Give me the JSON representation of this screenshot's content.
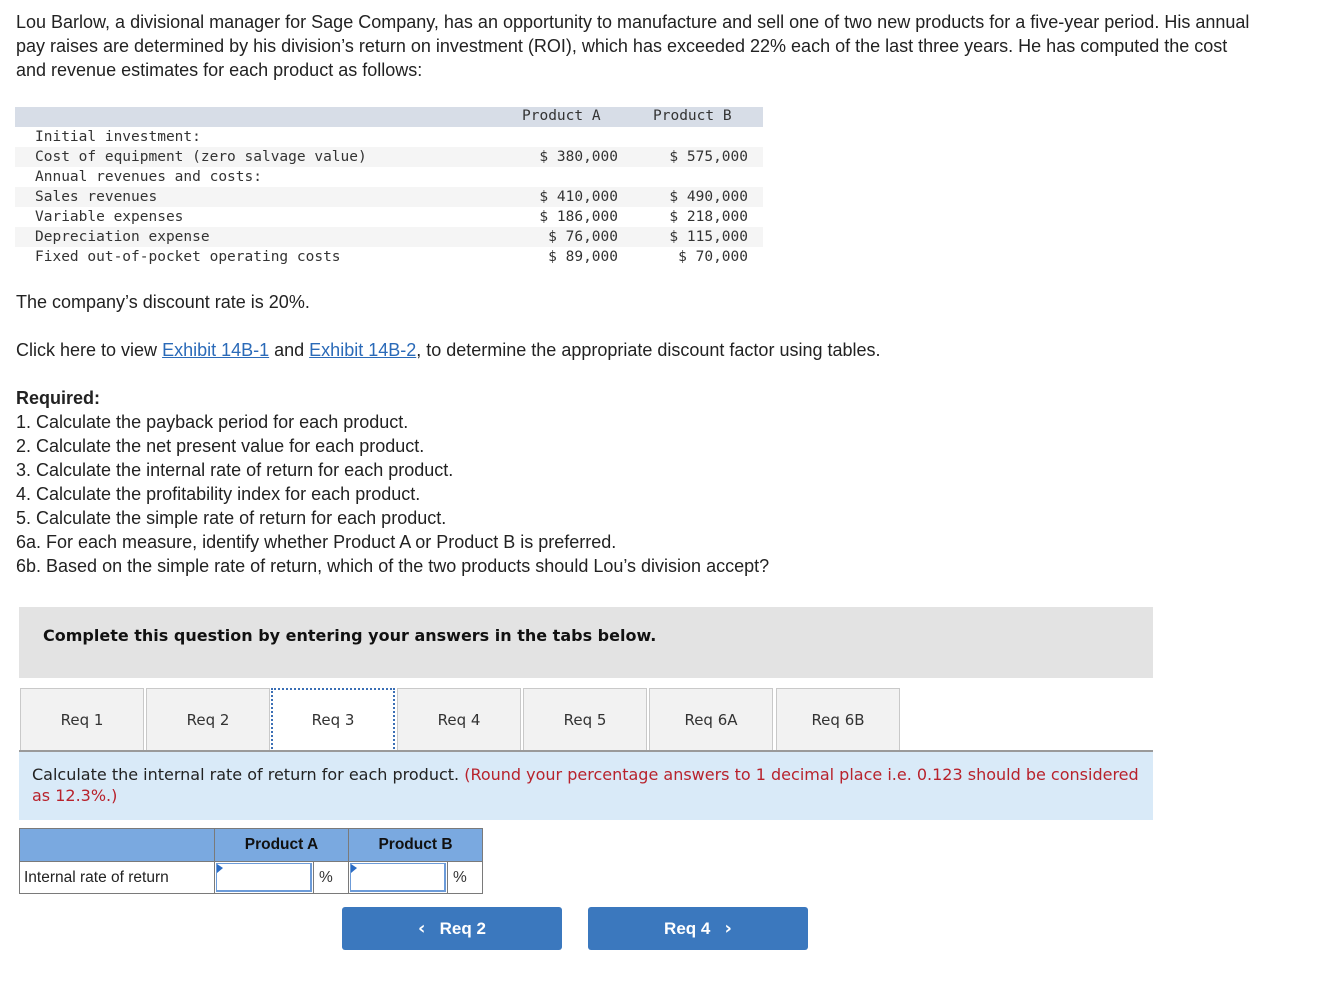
{
  "intro": "Lou Barlow, a divisional manager for Sage Company, has an opportunity to manufacture and sell one of two new products for a five-year period. His annual pay raises are determined by his division’s return on investment (ROI), which has exceeded 22% each of the last three years. He has computed the cost and revenue estimates for each product as follows:",
  "data_table": {
    "columns": [
      "Product A",
      "Product B"
    ],
    "rows": [
      {
        "label": "Initial investment:",
        "a": "",
        "b": ""
      },
      {
        "label": "Cost of equipment (zero salvage value)",
        "a": "$ 380,000",
        "b": "$ 575,000"
      },
      {
        "label": "Annual revenues and costs:",
        "a": "",
        "b": ""
      },
      {
        "label": "Sales revenues",
        "a": "$ 410,000",
        "b": "$ 490,000"
      },
      {
        "label": "Variable expenses",
        "a": "$ 186,000",
        "b": "$ 218,000"
      },
      {
        "label": "Depreciation expense",
        "a": "$ 76,000",
        "b": "$ 115,000"
      },
      {
        "label": "Fixed out-of-pocket operating costs",
        "a": "$ 89,000",
        "b": "$ 70,000"
      }
    ]
  },
  "discount_text": "The company’s discount rate is 20%.",
  "exhibit": {
    "prefix": "Click here to view ",
    "link1": "Exhibit 14B-1",
    "middle": " and ",
    "link2": "Exhibit 14B-2",
    "suffix": ", to determine the appropriate discount factor using tables."
  },
  "required": {
    "title": "Required:",
    "items": [
      "1. Calculate the payback period for each product.",
      "2. Calculate the net present value for each product.",
      "3. Calculate the internal rate of return for each product.",
      "4. Calculate the profitability index for each product.",
      "5. Calculate the simple rate of return for each product.",
      "6a. For each measure, identify whether Product A or Product B is preferred.",
      "6b. Based on the simple rate of return, which of the two products should Lou’s division accept?"
    ]
  },
  "banner": "Complete this question by entering your answers in the tabs below.",
  "tabs": [
    {
      "label": "Req 1",
      "active": false
    },
    {
      "label": "Req 2",
      "active": false
    },
    {
      "label": "Req 3",
      "active": true
    },
    {
      "label": "Req 4",
      "active": false
    },
    {
      "label": "Req 5",
      "active": false
    },
    {
      "label": "Req 6A",
      "active": false
    },
    {
      "label": "Req 6B",
      "active": false
    }
  ],
  "instruction": {
    "text": "Calculate the internal rate of return for each product. ",
    "note": "(Round your percentage answers to 1 decimal place i.e. 0.123 should be considered as 12.3%.)"
  },
  "answer_table": {
    "col_a": "Product A",
    "col_b": "Product B",
    "row_label": "Internal rate of return",
    "value_a": "",
    "value_b": "",
    "unit": "%"
  },
  "nav": {
    "prev_label": "Req 2",
    "next_label": "Req 4",
    "prev_icon": "‹",
    "next_icon": "›"
  },
  "colors": {
    "link": "#2a6ab8",
    "note_red": "#b8222c",
    "button_blue": "#3b78be",
    "header_blue": "#7aa9e0",
    "instruction_bg": "#d9eaf8"
  }
}
